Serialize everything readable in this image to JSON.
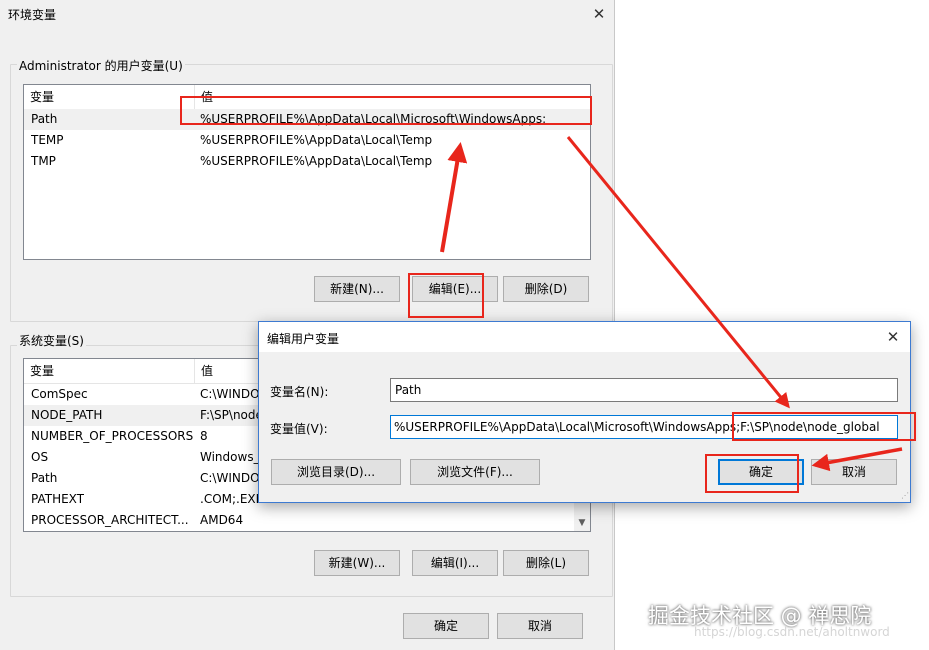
{
  "env_dialog": {
    "title": "环境变量",
    "close_glyph": "✕",
    "user_group": {
      "label": "Administrator 的用户变量(U)",
      "columns": [
        "变量",
        "值"
      ],
      "rows": [
        {
          "name": "Path",
          "value": "%USERPROFILE%\\AppData\\Local\\Microsoft\\WindowsApps;"
        },
        {
          "name": "TEMP",
          "value": "%USERPROFILE%\\AppData\\Local\\Temp"
        },
        {
          "name": "TMP",
          "value": "%USERPROFILE%\\AppData\\Local\\Temp"
        }
      ],
      "buttons": {
        "new": "新建(N)...",
        "edit": "编辑(E)...",
        "delete": "删除(D)"
      }
    },
    "system_group": {
      "label": "系统变量(S)",
      "columns": [
        "变量",
        "值"
      ],
      "rows": [
        {
          "name": "ComSpec",
          "value": "C:\\WINDO"
        },
        {
          "name": "NODE_PATH",
          "value": "F:\\SP\\node"
        },
        {
          "name": "NUMBER_OF_PROCESSORS",
          "value": "8"
        },
        {
          "name": "OS",
          "value": "Windows_"
        },
        {
          "name": "Path",
          "value": "C:\\WINDO"
        },
        {
          "name": "PATHEXT",
          "value": ".COM;.EXE"
        },
        {
          "name": "PROCESSOR_ARCHITECT...",
          "value": "AMD64"
        }
      ],
      "buttons": {
        "new": "新建(W)...",
        "edit": "编辑(I)...",
        "delete": "删除(L)"
      }
    },
    "ok_label": "确定",
    "cancel_label": "取消"
  },
  "edit_dialog": {
    "title": "编辑用户变量",
    "close_glyph": "✕",
    "name_label": "变量名(N):",
    "name_value": "Path",
    "value_label": "变量值(V):",
    "value_value": "%USERPROFILE%\\AppData\\Local\\Microsoft\\WindowsApps;F:\\SP\\node\\node_global",
    "browse_dir_label": "浏览目录(D)...",
    "browse_file_label": "浏览文件(F)...",
    "ok_label": "确定",
    "cancel_label": "取消"
  },
  "annotation_color": "#e8261c",
  "watermark": {
    "text": "掘金技术社区 @ 禅思院",
    "url": "https://blog.csdn.net/aholtnword"
  }
}
